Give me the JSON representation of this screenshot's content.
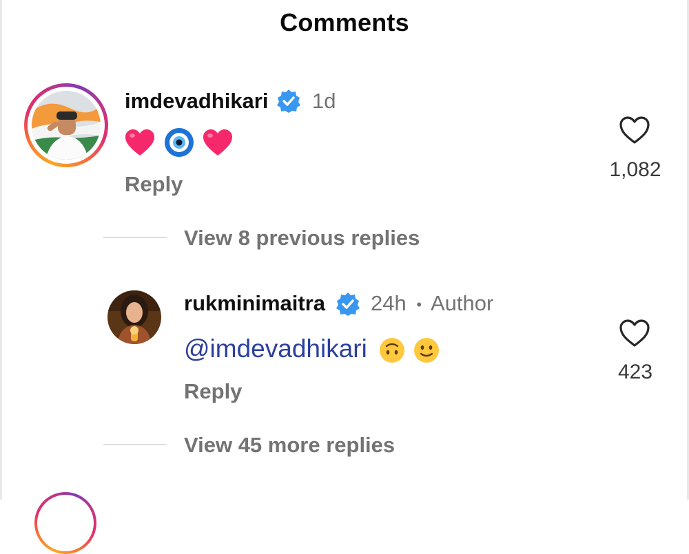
{
  "header": {
    "title": "Comments"
  },
  "comments": [
    {
      "username": "imdevadhikari",
      "time": "1d",
      "text_emojis": [
        "red-heart",
        "nazar-amulet",
        "red-heart"
      ],
      "reply_label": "Reply",
      "likes": "1,082",
      "icons": {
        "avatar": "user-avatar-flag",
        "like": "heart-outline-icon",
        "badge": "verified-badge-icon"
      }
    }
  ],
  "thread_previous": {
    "label": "View 8 previous replies"
  },
  "reply": {
    "username": "rukminimaitra",
    "time": "24h",
    "separator": "•",
    "author_tag": "Author",
    "mention": "@imdevadhikari",
    "text_emojis": [
      "upside-down-face",
      "slightly-smiling-face"
    ],
    "reply_label": "Reply",
    "likes": "423"
  },
  "thread_more": {
    "label": "View 45 more replies"
  },
  "colors": {
    "verified": "#3897f0",
    "mention": "#2b3f9c",
    "secondary_text": "#737373"
  }
}
